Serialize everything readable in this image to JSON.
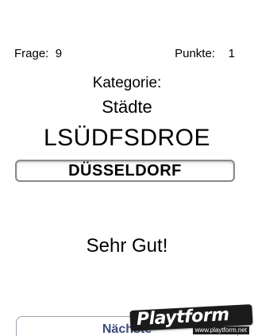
{
  "stats": {
    "question_label": "Frage:",
    "question_value": "9",
    "points_label": "Punkte:",
    "points_value": "1"
  },
  "category": {
    "label": "Kategorie:",
    "value": "Städte"
  },
  "puzzle": {
    "scrambled": "LSÜDFSDROE",
    "answer": "DÜSSELDORF"
  },
  "result_text": "Sehr Gut!",
  "next_button_label": "Nächste",
  "watermark": {
    "brand": "Playtform",
    "url": "www.playtform.net"
  }
}
